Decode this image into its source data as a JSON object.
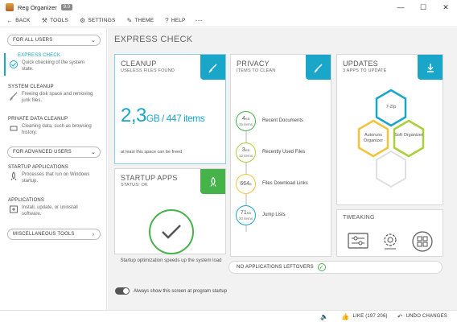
{
  "window": {
    "title": "Reg Organizer",
    "version": "9.0",
    "minimize": "—",
    "maximize": "☐",
    "close": "✕"
  },
  "menu": {
    "back": "BACK",
    "tools": "TOOLS",
    "settings": "SETTINGS",
    "theme": "THEME",
    "help": "HELP",
    "more": "⋯"
  },
  "sidebar": {
    "all_users": "FOR ALL USERS",
    "advanced_users": "FOR ADVANCED USERS",
    "misc_tools": "MISCELLANEOUS TOOLS",
    "items": [
      {
        "title": "EXPRESS CHECK",
        "desc": "Quick checking of the system state."
      },
      {
        "title": "SYSTEM CLEANUP",
        "desc": "Freeing disk space and removing junk files."
      },
      {
        "title": "PRIVATE DATA CLEANUP",
        "desc": "Cleaning data, such as browsing history."
      },
      {
        "title": "STARTUP APPLICATIONS",
        "desc": "Processes that run on Windows startup."
      },
      {
        "title": "APPLICATIONS",
        "desc": "Install, update, or uninstall software."
      }
    ]
  },
  "main": {
    "title": "EXPRESS CHECK",
    "cleanup": {
      "title": "CLEANUP",
      "subtitle": "USELESS FILES FOUND",
      "size": "2,3",
      "unit": "GB / 447 items",
      "note": "at least this space can be freed"
    },
    "startup": {
      "title": "STARTUP APPS",
      "status": "STATUS: OK",
      "note": "Startup optimization speeds up the system load"
    },
    "privacy": {
      "title": "PRIVACY",
      "subtitle": "ITEMS TO CLEAN",
      "rows": [
        {
          "num": "4",
          "unit": "KB",
          "count": "15 items",
          "label": "Recent Documents",
          "color": "#45b24a"
        },
        {
          "num": "3",
          "unit": "KB",
          "count": "13 items",
          "label": "Recently Used Files",
          "color": "#a9cf3b"
        },
        {
          "num": "664",
          "unit": "B",
          "count": "",
          "label": "Files Download Links",
          "color": "#f0c53c"
        },
        {
          "num": "71",
          "unit": "KB",
          "count": "20 items",
          "label": "Jump Lists",
          "color": "#1aa6c8"
        }
      ]
    },
    "updates": {
      "title": "UPDATES",
      "subtitle": "3 APPS TO UPDATE",
      "apps": [
        "7-Zip",
        "Autoruns Organizer",
        "Soft Organizer"
      ]
    },
    "tweaking": {
      "title": "TWEAKING"
    },
    "leftovers": "NO APPLICATIONS LEFTOVERS",
    "toggle_label": "Always show this screen at program startup"
  },
  "statusbar": {
    "like": "LIKE (197 206)",
    "undo": "UNDO CHANGES"
  },
  "colors": {
    "accent": "#1aa6c8",
    "green": "#45b24a",
    "yellow": "#f0c53c"
  }
}
